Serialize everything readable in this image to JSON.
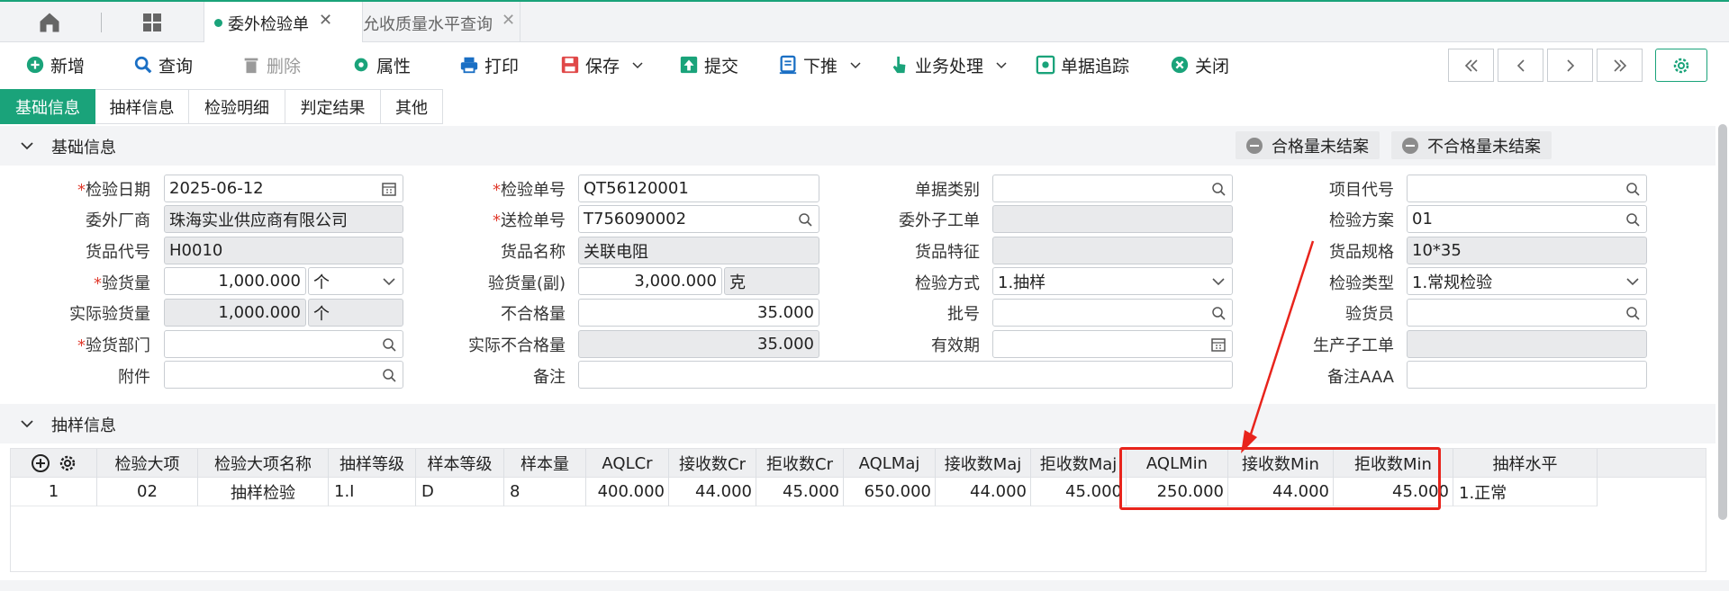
{
  "tabs": {
    "active": "委外检验单",
    "inactive": "允收质量水平查询",
    "close": "✕"
  },
  "toolbar": {
    "new": "新增",
    "query": "查询",
    "delete": "删除",
    "properties": "属性",
    "print": "打印",
    "save": "保存",
    "submit": "提交",
    "push_down": "下推",
    "business": "业务处理",
    "trace": "单据追踪",
    "close": "关闭"
  },
  "subtabs": [
    "基础信息",
    "抽样信息",
    "检验明细",
    "判定结果",
    "其他"
  ],
  "section_basic": {
    "title": "基础信息",
    "btn_qualified": "合格量未结案",
    "btn_unqualified": "不合格量未结案"
  },
  "form": {
    "inspect_date": {
      "label": "检验日期",
      "value": "2025-06-12"
    },
    "outsource_vendor": {
      "label": "委外厂商",
      "value": "珠海实业供应商有限公司"
    },
    "item_code": {
      "label": "货品代号",
      "value": "H0010"
    },
    "inspect_qty": {
      "label": "验货量",
      "value": "1,000.000",
      "unit": "个"
    },
    "actual_inspect_qty": {
      "label": "实际验货量",
      "value": "1,000.000",
      "unit": "个"
    },
    "inspect_dept": {
      "label": "验货部门",
      "value": ""
    },
    "attachment": {
      "label": "附件",
      "value": ""
    },
    "inspect_no": {
      "label": "检验单号",
      "value": "QT56120001"
    },
    "send_no": {
      "label": "送检单号",
      "value": "T756090002"
    },
    "item_name": {
      "label": "货品名称",
      "value": "关联电阻"
    },
    "inspect_qty_sub": {
      "label": "验货量(副)",
      "value": "3,000.000",
      "unit": "克"
    },
    "unqualified_qty": {
      "label": "不合格量",
      "value": "35.000"
    },
    "actual_unqualified_qty": {
      "label": "实际不合格量",
      "value": "35.000"
    },
    "remark": {
      "label": "备注",
      "value": ""
    },
    "doc_type": {
      "label": "单据类别",
      "value": ""
    },
    "outsource_sub_order": {
      "label": "委外子工单",
      "value": ""
    },
    "item_feature": {
      "label": "货品特征",
      "value": ""
    },
    "inspect_method": {
      "label": "检验方式",
      "value": "1.抽样"
    },
    "batch_no": {
      "label": "批号",
      "value": ""
    },
    "expiry": {
      "label": "有效期",
      "value": ""
    },
    "project_code": {
      "label": "项目代号",
      "value": ""
    },
    "inspect_plan": {
      "label": "检验方案",
      "value": "01"
    },
    "item_spec": {
      "label": "货品规格",
      "value": "10*35"
    },
    "inspect_type": {
      "label": "检验类型",
      "value": "1.常规检验"
    },
    "inspector": {
      "label": "验货员",
      "value": ""
    },
    "production_sub_order": {
      "label": "生产子工单",
      "value": ""
    },
    "remark_aaa": {
      "label": "备注AAA",
      "value": ""
    }
  },
  "section_sampling": {
    "title": "抽样信息"
  },
  "grid": {
    "columns": [
      "检验大项",
      "检验大项名称",
      "抽样等级",
      "样本等级",
      "样本量",
      "AQLCr",
      "接收数Cr",
      "拒收数Cr",
      "AQLMaj",
      "接收数Maj",
      "拒收数Maj",
      "AQLMin",
      "接收数Min",
      "拒收数Min",
      "抽样水平"
    ],
    "rows": [
      [
        "1",
        "02",
        "抽样检验",
        "1.I",
        "D",
        "8",
        "400.000",
        "44.000",
        "45.000",
        "650.000",
        "44.000",
        "45.000",
        "250.000",
        "44.000",
        "45.000",
        "1.正常"
      ]
    ]
  },
  "colors": {
    "accent": "#1aa37a",
    "highlight": "#e8241c"
  }
}
